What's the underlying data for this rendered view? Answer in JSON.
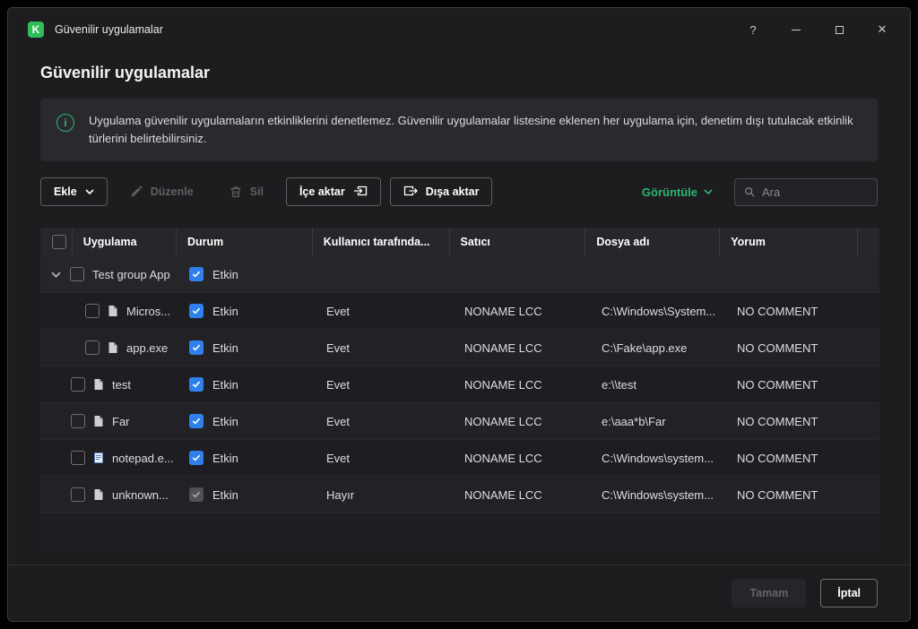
{
  "window": {
    "title": "Güvenilir uygulamalar",
    "help": "?"
  },
  "page": {
    "title": "Güvenilir uygulamalar",
    "info": "Uygulama güvenilir uygulamaların etkinliklerini denetlemez. Güvenilir uygulamalar listesine eklenen her uygulama için, denetim dışı tutulacak etkinlik türlerini belirtebilirsiniz."
  },
  "toolbar": {
    "add": "Ekle",
    "edit": "Düzenle",
    "delete": "Sil",
    "import": "İçe aktar",
    "export": "Dışa aktar",
    "view": "Görüntüle",
    "search_placeholder": "Ara"
  },
  "table": {
    "columns": {
      "app": "Uygulama",
      "status": "Durum",
      "user": "Kullanıcı tarafında...",
      "vendor": "Satıcı",
      "file": "Dosya adı",
      "comment": "Yorum"
    },
    "rows": [
      {
        "name": "Test group App",
        "status": "Etkin",
        "user": "",
        "vendor": "",
        "path": "",
        "comment": ""
      },
      {
        "name": "Micros...",
        "status": "Etkin",
        "user": "Evet",
        "vendor": "NONAME LCC",
        "path": "C:\\Windows\\System...",
        "comment": "NO COMMENT"
      },
      {
        "name": "app.exe",
        "status": "Etkin",
        "user": "Evet",
        "vendor": "NONAME LCC",
        "path": "C:\\Fake\\app.exe",
        "comment": "NO COMMENT"
      },
      {
        "name": "test",
        "status": "Etkin",
        "user": "Evet",
        "vendor": "NONAME LCC",
        "path": "e:\\\\test",
        "comment": "NO COMMENT"
      },
      {
        "name": "Far",
        "status": "Etkin",
        "user": "Evet",
        "vendor": "NONAME LCC",
        "path": "e:\\aaa*b\\Far",
        "comment": "NO COMMENT"
      },
      {
        "name": "notepad.e...",
        "status": "Etkin",
        "user": "Evet",
        "vendor": "NONAME LCC",
        "path": "C:\\Windows\\system...",
        "comment": "NO COMMENT"
      },
      {
        "name": "unknown...",
        "status": "Etkin",
        "user": "Hayır",
        "vendor": "NONAME LCC",
        "path": "C:\\Windows\\system...",
        "comment": "NO COMMENT"
      }
    ]
  },
  "footer": {
    "ok": "Tamam",
    "cancel": "İptal"
  },
  "colors": {
    "accent_green": "#2bb673",
    "checkbox_blue": "#2f80ed",
    "logo_green": "#2ebd59"
  }
}
